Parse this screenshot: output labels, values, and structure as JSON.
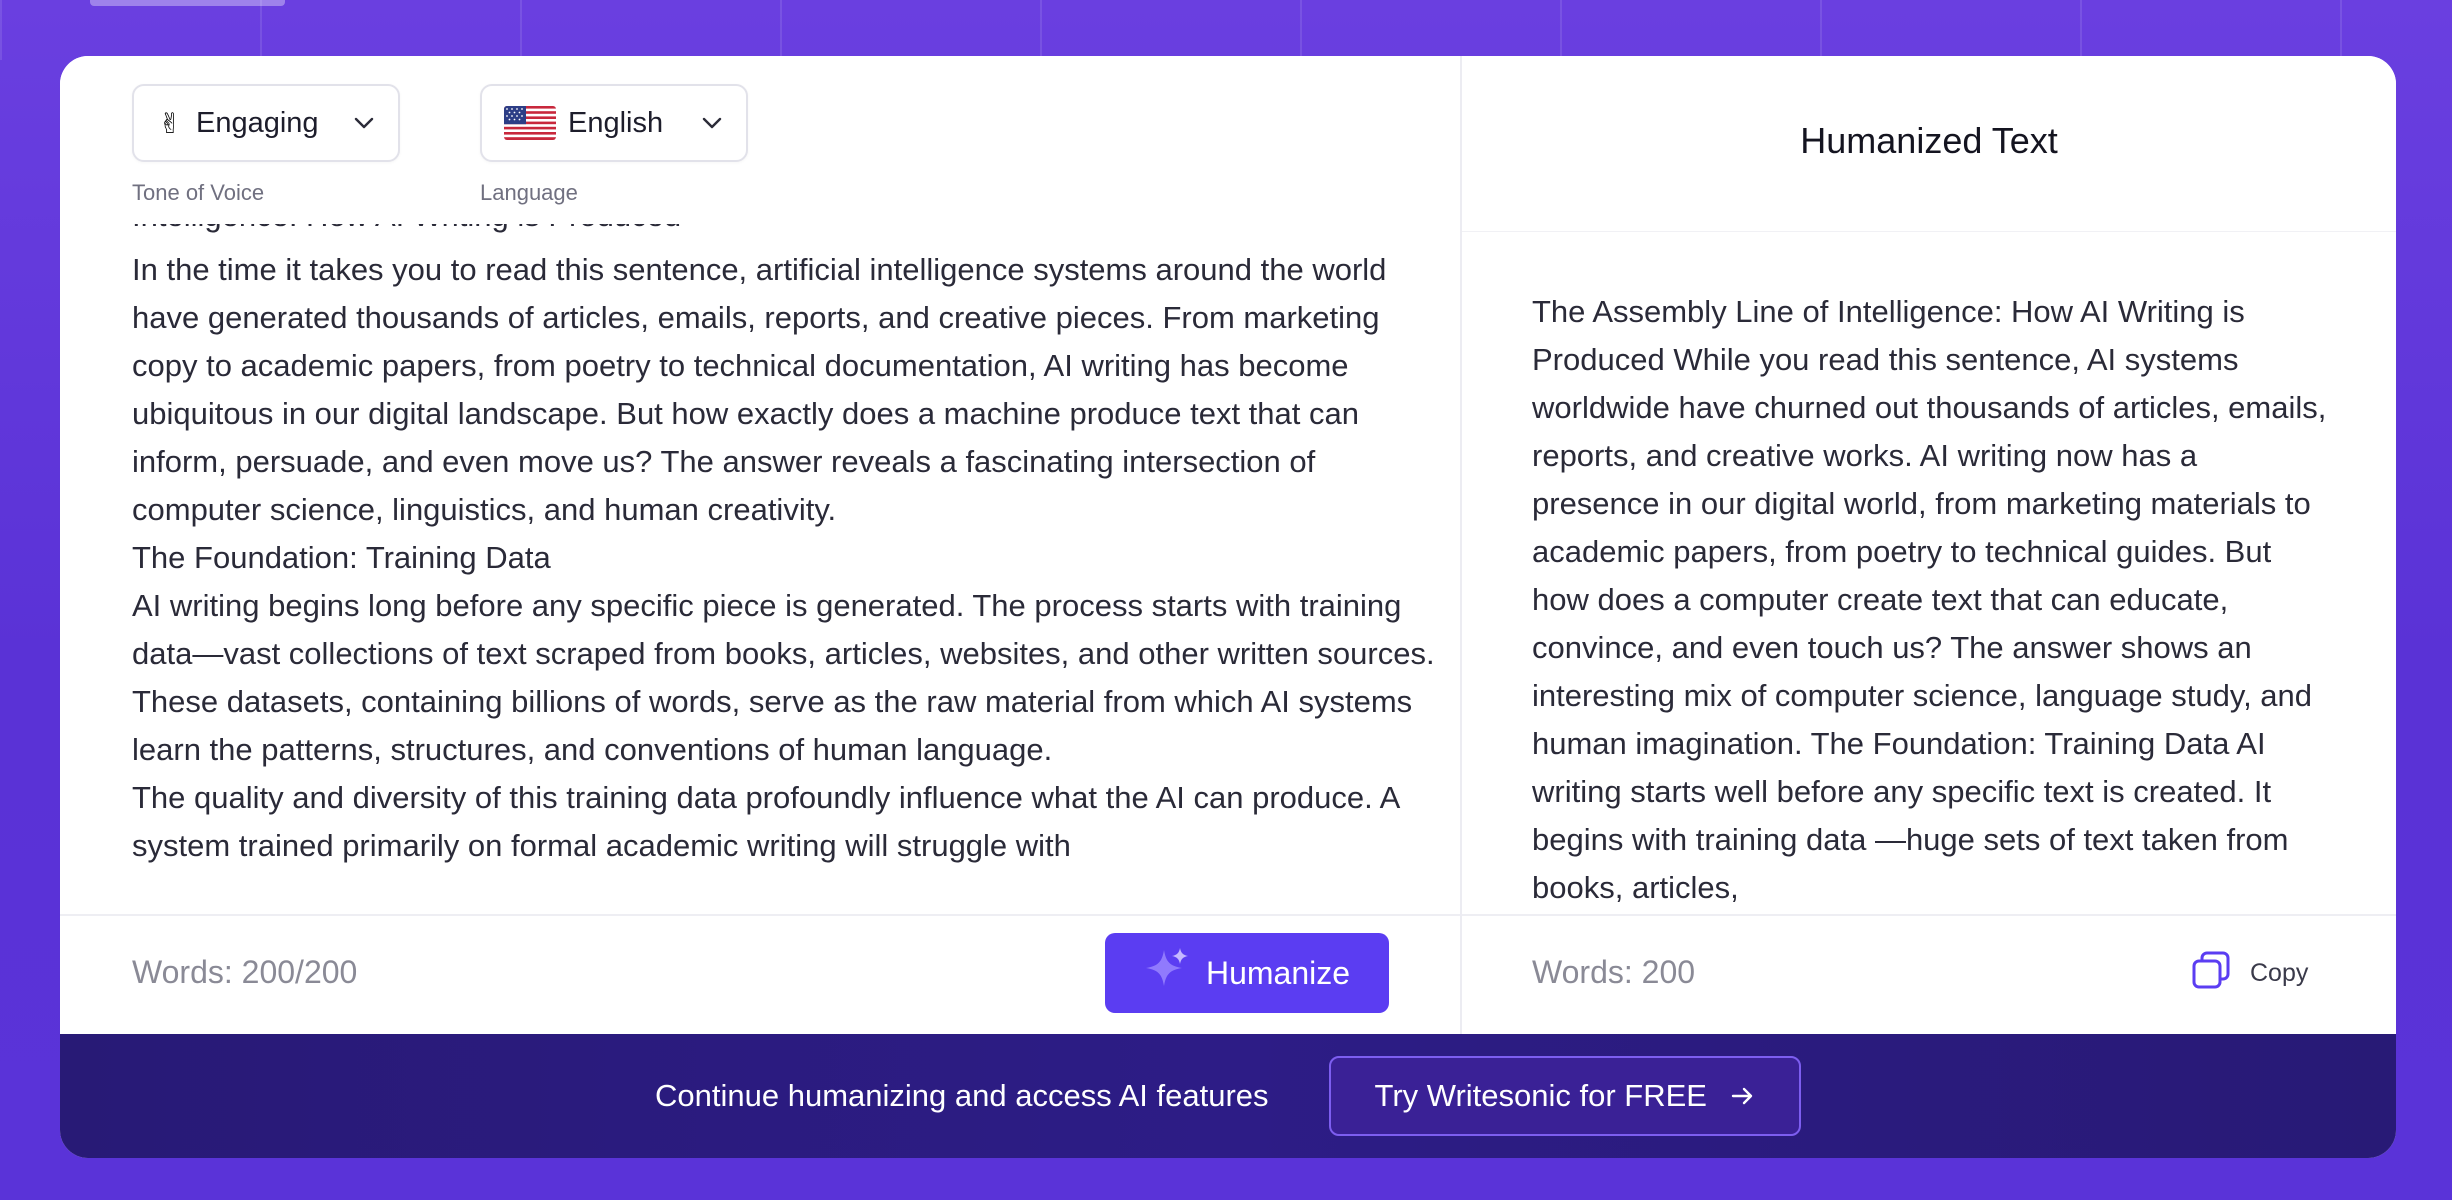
{
  "toolbar": {
    "tone": {
      "emoji": "✌",
      "value": "Engaging",
      "label": "Tone of Voice"
    },
    "language": {
      "value": "English",
      "label": "Language"
    }
  },
  "input": {
    "cut_line": "Intelligence: How AI Writing is Produced",
    "paragraphs": [
      "In the time it takes you to read this sentence, artificial intelligence systems around the world have generated thousands of articles, emails, reports, and creative pieces. From marketing copy to academic papers, from poetry to technical documentation, AI writing has become ubiquitous in our digital landscape. But how exactly does a machine produce text that can inform, persuade, and even move us? The answer reveals a fascinating intersection of computer science, linguistics, and human creativity.",
      "The Foundation: Training Data",
      "AI writing begins long before any specific piece is generated. The process starts with training data—vast collections of text scraped from books, articles, websites, and other written sources. These datasets, containing billions of words, serve as the raw material from which AI systems learn the patterns, structures, and conventions of human language.",
      "The quality and diversity of this training data profoundly influence what the AI can produce. A system trained primarily on formal academic writing will struggle with"
    ],
    "word_count": "Words: 200/200",
    "humanize_label": "Humanize"
  },
  "output": {
    "title": "Humanized Text",
    "text": "The Assembly Line of Intelligence: How AI Writing is Produced While you read this sentence, AI systems worldwide have churned out thousands of articles, emails, reports, and creative works. AI writing now has a presence in our digital world, from marketing materials to academic papers, from poetry to technical guides. But how does a computer create text that can educate, convince, and even touch us? The answer shows an interesting mix of computer science, language study, and human imagination. The Foundation: Training Data AI writing starts well before any specific text is created. It begins with training data —huge sets of text taken from books, articles,",
    "word_count": "Words: 200",
    "copy_label": "Copy"
  },
  "cta": {
    "text": "Continue humanizing and access AI features",
    "button_label": "Try Writesonic for FREE"
  },
  "colors": {
    "accent": "#5b3df2",
    "background": "#6a3fe0",
    "cta_bar": "#2a1b7e"
  }
}
